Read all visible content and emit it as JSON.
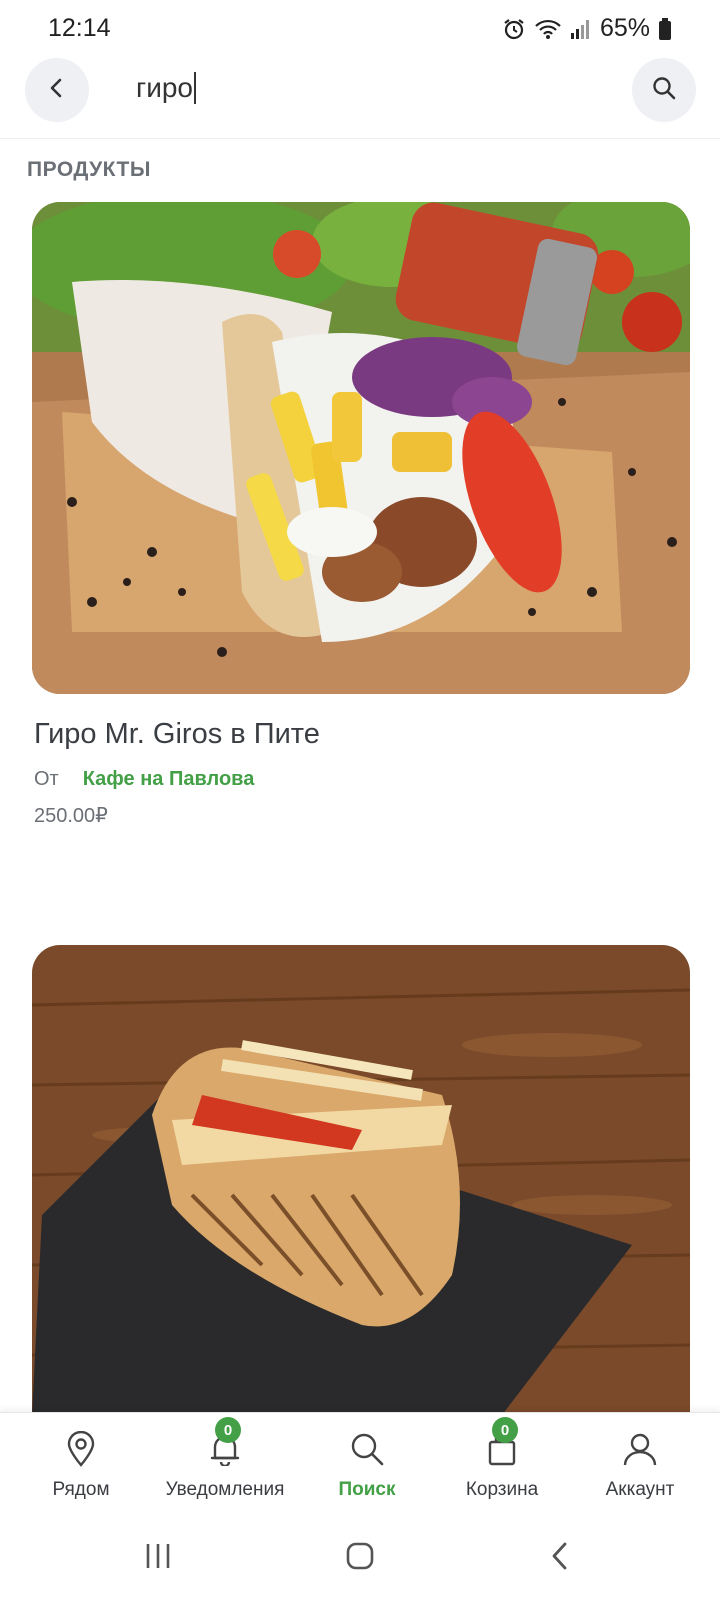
{
  "status_bar": {
    "time": "12:14",
    "battery": "65%"
  },
  "search": {
    "query": "гиро"
  },
  "section": {
    "title": "ПРОДУКТЫ"
  },
  "products": [
    {
      "name": "Гиро Mr. Giros в Пите",
      "from_label": "От",
      "vendor": "Кафе на Павлова",
      "price": "250.00₽"
    }
  ],
  "bottom_nav": {
    "items": [
      {
        "label": "Рядом",
        "icon": "location-pin-icon"
      },
      {
        "label": "Уведомления",
        "icon": "bell-icon",
        "badge": "0"
      },
      {
        "label": "Поиск",
        "icon": "search-icon",
        "active": true
      },
      {
        "label": "Корзина",
        "icon": "bag-icon",
        "badge": "0"
      },
      {
        "label": "Аккаунт",
        "icon": "user-icon"
      }
    ]
  },
  "colors": {
    "accent": "#43a047",
    "text": "#3a3d42",
    "muted": "#6b6f76"
  }
}
